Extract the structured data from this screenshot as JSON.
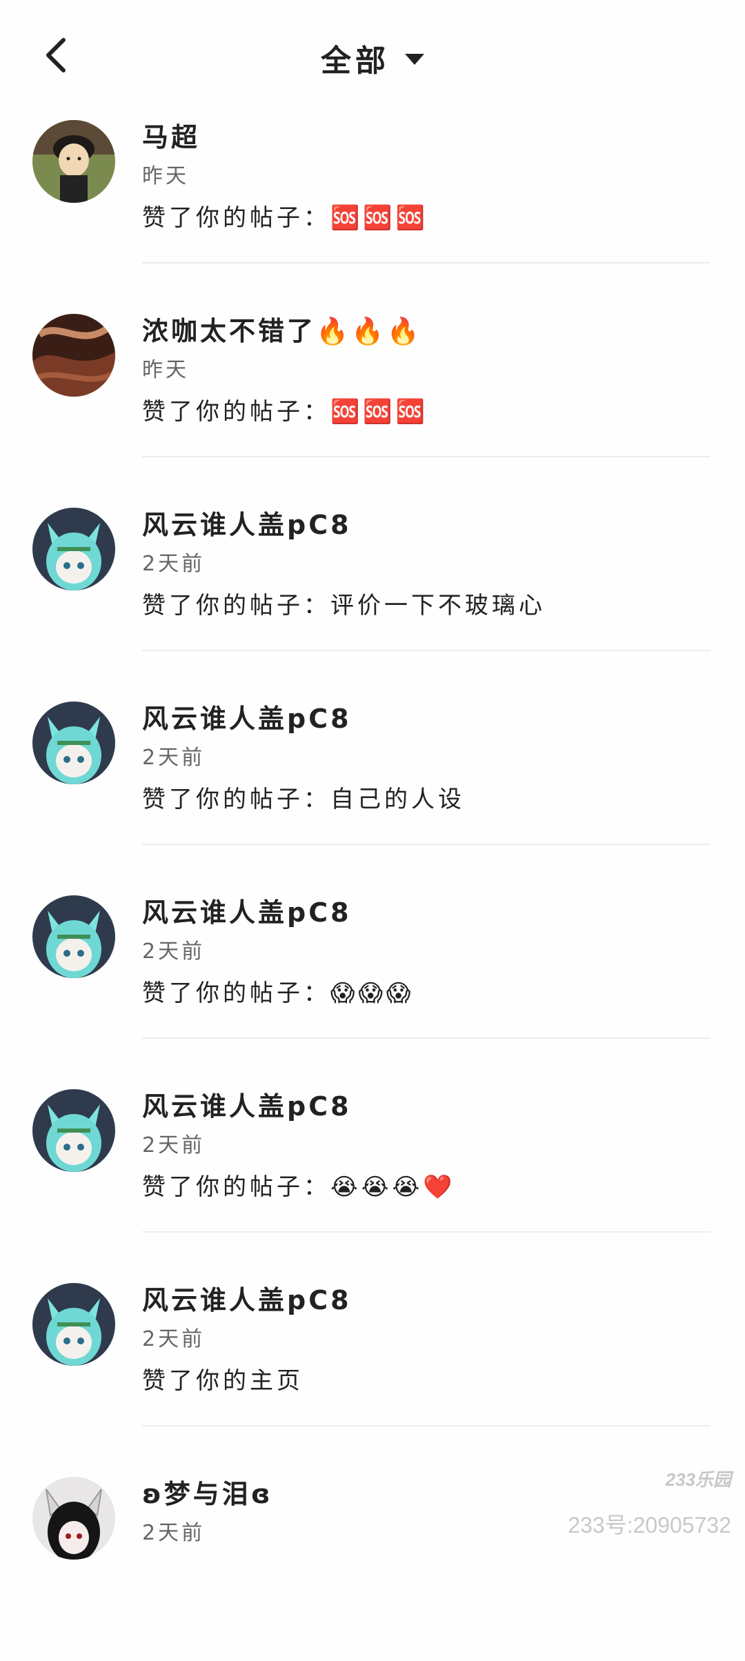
{
  "header": {
    "filter_label": "全部"
  },
  "items": [
    {
      "name": "马超",
      "time": "昨天",
      "action": "赞了你的帖子：🆘🆘🆘"
    },
    {
      "name": "浓咖太不错了🔥🔥🔥",
      "time": "昨天",
      "action": "赞了你的帖子：🆘🆘🆘"
    },
    {
      "name": "风云谁人盖pC8",
      "time": "2天前",
      "action": "赞了你的帖子：评价一下不玻璃心"
    },
    {
      "name": "风云谁人盖pC8",
      "time": "2天前",
      "action": "赞了你的帖子：自己的人设"
    },
    {
      "name": "风云谁人盖pC8",
      "time": "2天前",
      "action": "赞了你的帖子：😱😱😱"
    },
    {
      "name": "风云谁人盖pC8",
      "time": "2天前",
      "action": "赞了你的帖子：😭😭😭❤️"
    },
    {
      "name": "风云谁人盖pC8",
      "time": "2天前",
      "action": "赞了你的主页"
    },
    {
      "name": "ʚ梦与泪ɞ",
      "time": "2天前",
      "action": ""
    }
  ],
  "watermark": {
    "logo": "233乐园",
    "id": "233号:20905732"
  }
}
